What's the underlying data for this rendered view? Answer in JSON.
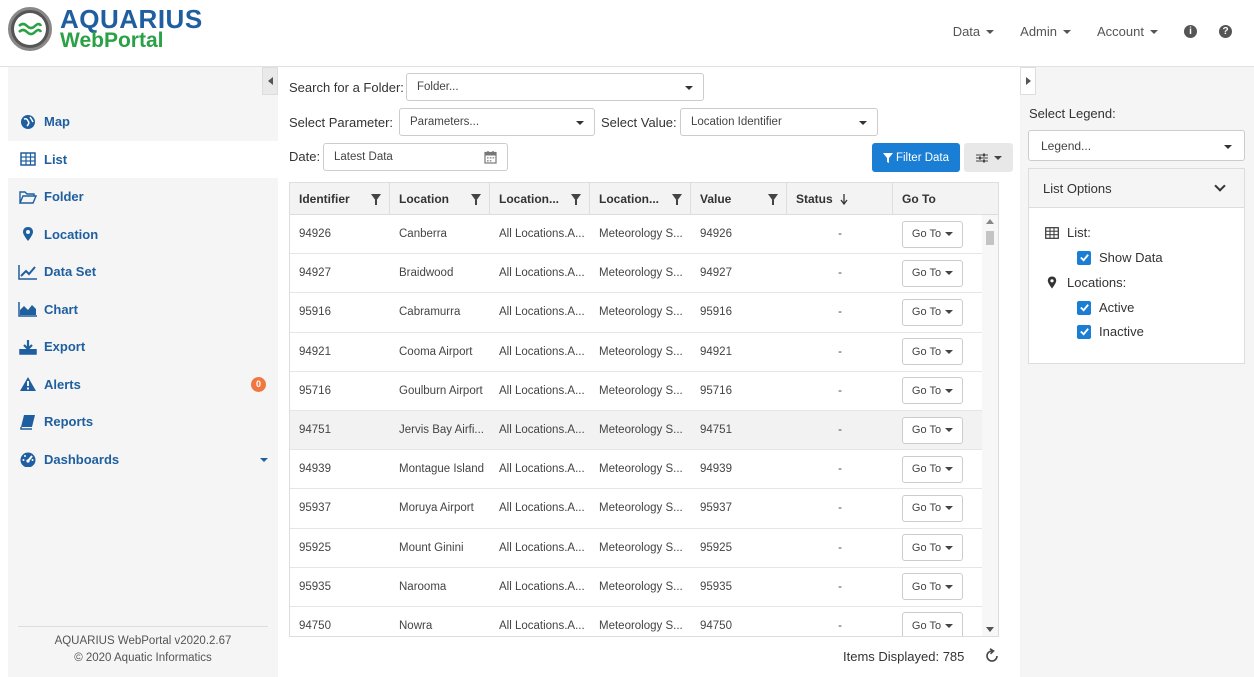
{
  "header": {
    "logo_main": "AQUARIUS",
    "logo_sub": "WebPortal",
    "nav": [
      "Data",
      "Admin",
      "Account"
    ]
  },
  "sidebar": {
    "items": [
      {
        "label": "Map",
        "icon": "globe-icon"
      },
      {
        "label": "List",
        "icon": "table-icon"
      },
      {
        "label": "Folder",
        "icon": "folder-icon"
      },
      {
        "label": "Location",
        "icon": "map-marker-icon"
      },
      {
        "label": "Data Set",
        "icon": "line-chart-icon"
      },
      {
        "label": "Chart",
        "icon": "area-chart-icon"
      },
      {
        "label": "Export",
        "icon": "download-icon"
      },
      {
        "label": "Alerts",
        "icon": "warning-icon",
        "badge": "0"
      },
      {
        "label": "Reports",
        "icon": "book-icon"
      },
      {
        "label": "Dashboards",
        "icon": "dashboard-icon"
      }
    ],
    "footer_version": "AQUARIUS WebPortal v2020.2.67",
    "footer_copyright": "© 2020 Aquatic Informatics"
  },
  "filters": {
    "folder_label": "Search for a Folder:",
    "folder_placeholder": "Folder...",
    "parameter_label": "Select Parameter:",
    "parameter_placeholder": "Parameters...",
    "value_label": "Select Value:",
    "value_selected": "Location Identifier",
    "date_label": "Date:",
    "date_value": "Latest Data",
    "filter_button": "Filter Data"
  },
  "table": {
    "columns": [
      "Identifier",
      "Location",
      "Location...",
      "Location...",
      "Value",
      "Status",
      "Go To"
    ],
    "goto_label": "Go To",
    "rows": [
      [
        "94926",
        "Canberra",
        "All Locations.A...",
        "Meteorology S...",
        "94926",
        "-"
      ],
      [
        "94927",
        "Braidwood",
        "All Locations.A...",
        "Meteorology S...",
        "94927",
        "-"
      ],
      [
        "95916",
        "Cabramurra",
        "All Locations.A...",
        "Meteorology S...",
        "95916",
        "-"
      ],
      [
        "94921",
        "Cooma Airport",
        "All Locations.A...",
        "Meteorology S...",
        "94921",
        "-"
      ],
      [
        "95716",
        "Goulburn Airport",
        "All Locations.A...",
        "Meteorology S...",
        "95716",
        "-"
      ],
      [
        "94751",
        "Jervis Bay Airfi...",
        "All Locations.A...",
        "Meteorology S...",
        "94751",
        "-"
      ],
      [
        "94939",
        "Montague Island",
        "All Locations.A...",
        "Meteorology S...",
        "94939",
        "-"
      ],
      [
        "95937",
        "Moruya Airport",
        "All Locations.A...",
        "Meteorology S...",
        "95937",
        "-"
      ],
      [
        "95925",
        "Mount Ginini",
        "All Locations.A...",
        "Meteorology S...",
        "95925",
        "-"
      ],
      [
        "95935",
        "Narooma",
        "All Locations.A...",
        "Meteorology S...",
        "95935",
        "-"
      ],
      [
        "94750",
        "Nowra",
        "All Locations.A...",
        "Meteorology S...",
        "94750",
        "-"
      ]
    ],
    "highlighted_row": 5,
    "items_displayed": "Items Displayed: 785"
  },
  "right_panel": {
    "legend_label": "Select Legend:",
    "legend_placeholder": "Legend...",
    "options_title": "List Options",
    "list_label": "List:",
    "show_data": "Show Data",
    "locations_label": "Locations:",
    "active": "Active",
    "inactive": "Inactive"
  },
  "colors": {
    "brand_blue": "#1f5fa0",
    "brand_green": "#2aa146",
    "primary_button": "#1a7fd4",
    "badge": "#f07840"
  }
}
